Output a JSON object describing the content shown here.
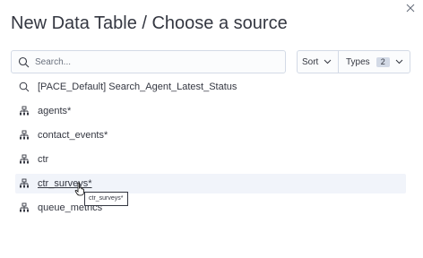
{
  "dialog": {
    "title": "New Data Table / Choose a source"
  },
  "search": {
    "placeholder": "Search..."
  },
  "filters": {
    "sort_label": "Sort",
    "types_label": "Types",
    "types_count": "2"
  },
  "sources": [
    {
      "label": "[PACE_Default] Search_Agent_Latest_Status",
      "icon": "search-icon"
    },
    {
      "label": "agents*",
      "icon": "index-pattern-icon"
    },
    {
      "label": "contact_events*",
      "icon": "index-pattern-icon"
    },
    {
      "label": "ctr",
      "icon": "index-pattern-icon"
    },
    {
      "label": "ctr_surveys*",
      "icon": "index-pattern-icon"
    },
    {
      "label": "queue_metrics",
      "icon": "index-pattern-icon"
    }
  ],
  "tooltip": {
    "text": "ctr_surveys*"
  },
  "colors": {
    "text": "#343741",
    "border": "#d3dae6",
    "hover_row": "#f1f4fa",
    "muted": "#69707d"
  }
}
